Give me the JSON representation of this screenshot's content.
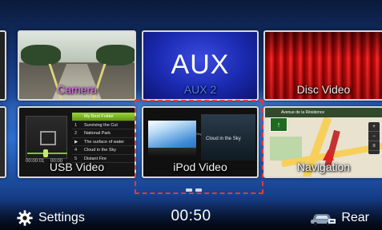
{
  "tiles": {
    "camera": {
      "label": "Camera"
    },
    "aux": {
      "label": "AUX 2",
      "big_text": "AUX"
    },
    "disc": {
      "label": "Disc Video"
    },
    "usb": {
      "label": "USB Video",
      "time_start": "00:00:01",
      "time_end": "00:00",
      "playlist": [
        {
          "num": "",
          "title": "My Best Folder"
        },
        {
          "num": "1",
          "title": "Surviving the Cut"
        },
        {
          "num": "2",
          "title": "National Park"
        },
        {
          "num": "▶",
          "title": "The surface of water"
        },
        {
          "num": "4",
          "title": "Cloud in the Sky"
        },
        {
          "num": "5",
          "title": "Distant Fire"
        }
      ]
    },
    "ipod": {
      "label": "iPod Video",
      "track_title": "Cloud in the Sky",
      "small": "Sky"
    },
    "nav": {
      "label": "Navigation",
      "street": "Avenue de la Résidence",
      "sign": "↑",
      "side_buttons": [
        "+",
        "−",
        "≡"
      ]
    }
  },
  "bottom_bar": {
    "settings_label": "Settings",
    "clock": "00:50",
    "rear_label": "Rear"
  },
  "colors": {
    "camera_label": "#e66cf5",
    "aux_label": "#4f7bff",
    "selection": "#e23a3a"
  },
  "icons": {
    "settings": "gear-icon",
    "rear": "rear-car-icon"
  }
}
